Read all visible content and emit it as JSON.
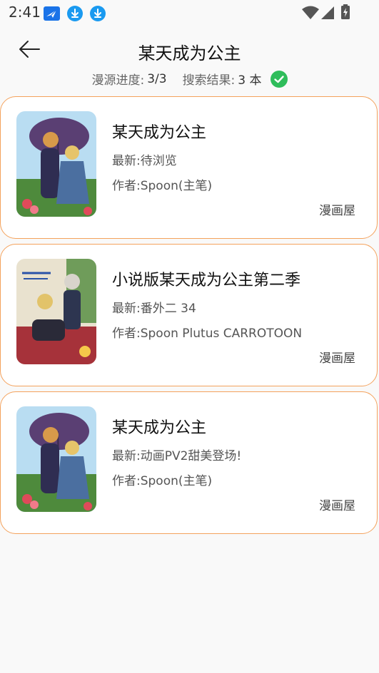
{
  "status_bar": {
    "time": "2:41",
    "icons": [
      "plane-app-icon",
      "download-icon",
      "download-icon",
      "wifi-icon",
      "signal-icon",
      "battery-icon"
    ]
  },
  "header": {
    "title": "某天成为公主",
    "back_icon": "arrow-left-icon"
  },
  "search_status": {
    "progress_label": "漫源进度:",
    "progress_value": "3/3",
    "result_label": "搜索结果:",
    "result_value": "3 本",
    "done_icon": "check-circle-icon",
    "accent_color": "#2fbd5b"
  },
  "colors": {
    "card_border": "#f4a25c",
    "background": "#f9f9f9"
  },
  "results": [
    {
      "title": "某天成为公主",
      "latest": "最新:待浏览",
      "author": "作者:Spoon(主笔)",
      "source": "漫画屋",
      "cover_icon": "manga-cover-image"
    },
    {
      "title": "小说版某天成为公主第二季",
      "latest": "最新:番外二 34",
      "author": "作者:Spoon Plutus CARROTOON",
      "source": "漫画屋",
      "cover_icon": "manga-cover-image"
    },
    {
      "title": "某天成为公主",
      "latest": "最新:动画PV2甜美登场!",
      "author": "作者:Spoon(主笔)",
      "source": "漫画屋",
      "cover_icon": "manga-cover-image"
    }
  ]
}
